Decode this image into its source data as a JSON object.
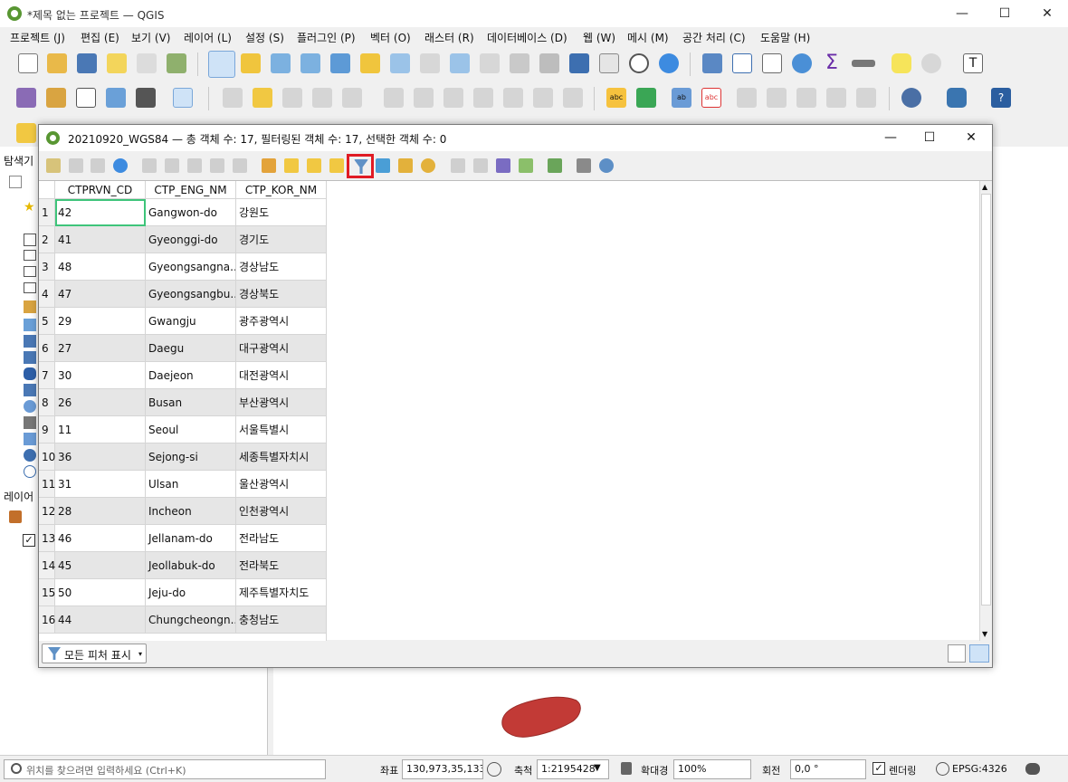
{
  "window": {
    "title": "*제목 없는 프로젝트 — QGIS",
    "minimize": "—",
    "maximize": "☐",
    "close": "✕"
  },
  "menu": [
    "프로젝트 (J)",
    "편집 (E)",
    "보기 (V)",
    "레이어 (L)",
    "설정 (S)",
    "플러그인 (P)",
    "벡터 (O)",
    "래스터 (R)",
    "데이터베이스 (D)",
    "웹 (W)",
    "메시 (M)",
    "공간 처리 (C)",
    "도움말 (H)"
  ],
  "panels": {
    "browser_title": "탐색기",
    "layers_title": "레이어"
  },
  "dialog": {
    "title": "20210920_WGS84 — 총 객체 수: 17, 필터링된 객체 수: 17, 선택한 객체 수: 0",
    "minimize": "—",
    "maximize": "☐",
    "close": "✕",
    "columns": [
      "CTPRVN_CD",
      "CTP_ENG_NM",
      "CTP_KOR_NM"
    ],
    "rows": [
      {
        "n": "1",
        "cd": "42",
        "eng": "Gangwon-do",
        "kor": "강원도"
      },
      {
        "n": "2",
        "cd": "41",
        "eng": "Gyeonggi-do",
        "kor": "경기도"
      },
      {
        "n": "3",
        "cd": "48",
        "eng": "Gyeongsangna...",
        "kor": "경상남도"
      },
      {
        "n": "4",
        "cd": "47",
        "eng": "Gyeongsangbu...",
        "kor": "경상북도"
      },
      {
        "n": "5",
        "cd": "29",
        "eng": "Gwangju",
        "kor": "광주광역시"
      },
      {
        "n": "6",
        "cd": "27",
        "eng": "Daegu",
        "kor": "대구광역시"
      },
      {
        "n": "7",
        "cd": "30",
        "eng": "Daejeon",
        "kor": "대전광역시"
      },
      {
        "n": "8",
        "cd": "26",
        "eng": "Busan",
        "kor": "부산광역시"
      },
      {
        "n": "9",
        "cd": "11",
        "eng": "Seoul",
        "kor": "서울특별시"
      },
      {
        "n": "10",
        "cd": "36",
        "eng": "Sejong-si",
        "kor": "세종특별자치시"
      },
      {
        "n": "11",
        "cd": "31",
        "eng": "Ulsan",
        "kor": "울산광역시"
      },
      {
        "n": "12",
        "cd": "28",
        "eng": "Incheon",
        "kor": "인천광역시"
      },
      {
        "n": "13",
        "cd": "46",
        "eng": "Jellanam-do",
        "kor": "전라남도"
      },
      {
        "n": "14",
        "cd": "45",
        "eng": "Jeollabuk-do",
        "kor": "전라북도"
      },
      {
        "n": "15",
        "cd": "50",
        "eng": "Jeju-do",
        "kor": "제주특별자치도"
      },
      {
        "n": "16",
        "cd": "44",
        "eng": "Chungcheongn...",
        "kor": "충청남도"
      }
    ],
    "show_all_label": "모든 피처 표시"
  },
  "statusbar": {
    "locator_placeholder": "위치를 찾으려면 입력하세요 (Ctrl+K)",
    "coord_label": "좌표",
    "coord_value": "130,973,35,133",
    "scale_label": "축척",
    "scale_value": "1:2195428",
    "magnifier_label": "확대경",
    "magnifier_value": "100%",
    "rotation_label": "회전",
    "rotation_value": "0,0 °",
    "render_label": "렌더링",
    "crs_label": "EPSG:4326"
  },
  "colors": {
    "qgis_green": "#589632",
    "filter_highlight": "#e01b24",
    "selection_cell": "#3ec47a",
    "jeju_fill": "#c23a36"
  }
}
